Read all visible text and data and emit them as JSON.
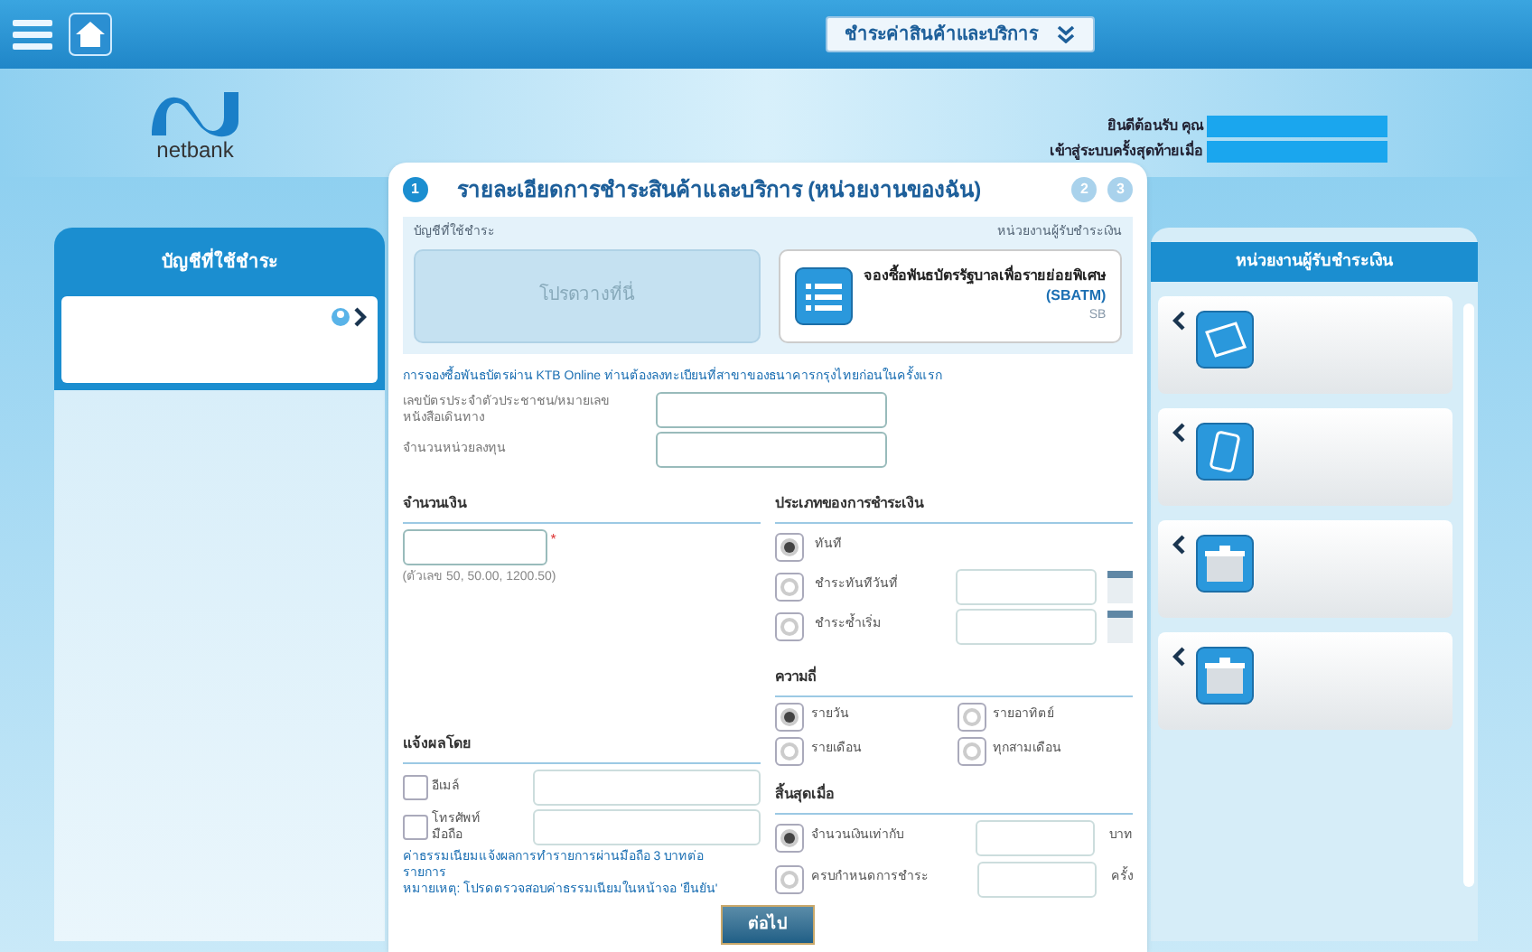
{
  "top_bar": {
    "menu_dropdown": "ชำระค่าสินค้าและบริการ"
  },
  "logo": "netbank",
  "welcome": {
    "greeting": "ยินดีต้อนรับ คุณ",
    "last_login": "เข้าสู่ระบบครั้งสุดท้ายเมื่อ"
  },
  "steps": [
    {
      "label": "1",
      "selected": true
    },
    {
      "label": "2",
      "selected": false
    },
    {
      "label": "3",
      "selected": false
    }
  ],
  "title": "รายละเอียดการชำระสินค้าและบริการ (หน่วยงานของฉัน)",
  "left_panel": {
    "title": "บัญชีที่ใช้ชำระ"
  },
  "selection": {
    "account_label": "บัญชีที่ใช้ชำระ",
    "payee_label": "หน่วยงานผู้รับชำระเงิน",
    "drop_zone": "โปรดวางที่นี่",
    "payee_card": {
      "name": "จองซื้อพันธบัตรรัฐบาลเพื่อรายย่อยพิเศษ",
      "code": "(SBATM)",
      "short": "SB"
    }
  },
  "notice": "การจองซื้อพันธบัตรผ่าน KTB Online ท่านต้องลงทะเบียนที่สาขาของธนาคารกรุงไทยก่อนในครั้งแรก",
  "id_fields": [
    {
      "label": "เลขบัตรประจำตัวประชาชน/หมายเลขหนังสือเดินทาง"
    },
    {
      "label": "จำนวนหน่วยลงทุน"
    }
  ],
  "amount": {
    "heading": "จำนวนเงิน",
    "required_mark": "*",
    "hint": "(ตัวเลข 50, 50.00, 1200.50)"
  },
  "payment_type": {
    "heading": "ประเภทของการชำระเงิน",
    "options": [
      {
        "label": "ทันที",
        "selected": true,
        "kind": "plain"
      },
      {
        "label": "ชำระทันทีวันที่",
        "selected": false,
        "kind": "date"
      },
      {
        "label": "ชำระซ้ำเริ่ม",
        "selected": false,
        "kind": "date"
      }
    ]
  },
  "notify": {
    "heading": "แจ้งผลโดย",
    "options": [
      {
        "label": "อีเมล์",
        "checked": false
      },
      {
        "label": "โทรศัพท์มือถือ",
        "checked": false
      }
    ],
    "fee_note": "ค่าธรรมเนียมแจ้งผลการทำรายการผ่านมือถือ 3 บาทต่อรายการ",
    "remark": "หมายเหตุ: โปรดตรวจสอบค่าธรรมเนียมในหน้าจอ 'ยืนยัน'"
  },
  "frequency": {
    "heading": "ความถี่",
    "options": [
      {
        "label": "รายวัน",
        "selected": true
      },
      {
        "label": "รายอาทิตย์",
        "selected": false
      },
      {
        "label": "รายเดือน",
        "selected": false
      },
      {
        "label": "ทุกสามเดือน",
        "selected": false
      }
    ]
  },
  "end_condition": {
    "heading": "สิ้นสุดเมื่อ",
    "options": [
      {
        "label": "จำนวนเงินเท่ากับ",
        "selected": true,
        "unit": "บาท"
      },
      {
        "label": "ครบกำหนดการชำระ",
        "selected": false,
        "unit": "ครั้ง"
      }
    ]
  },
  "next_button": "ต่อไป",
  "right_panel": {
    "title": "หน่วยงานผู้รับชำระเงิน",
    "payees": [
      {
        "kind": "tag"
      },
      {
        "kind": "phone"
      },
      {
        "kind": "box"
      },
      {
        "kind": "box"
      }
    ]
  }
}
